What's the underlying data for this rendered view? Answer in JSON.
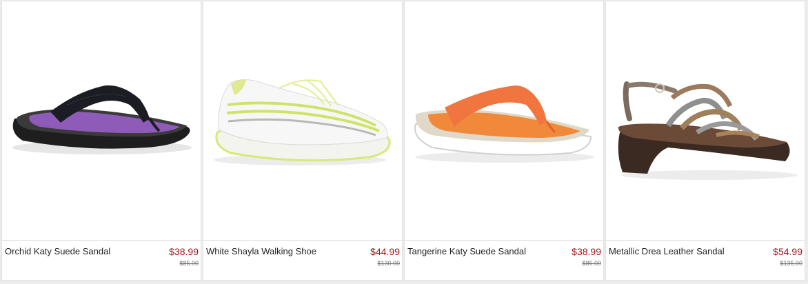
{
  "products": [
    {
      "name": "Orchid Katy Suede Sandal",
      "price": "$38.99",
      "original_price": "$85.00",
      "image_icon": "black-purple-thong-sandal"
    },
    {
      "name": "White Shayla Walking Shoe",
      "price": "$44.99",
      "original_price": "$130.00",
      "image_icon": "white-lime-sneaker"
    },
    {
      "name": "Tangerine Katy Suede Sandal",
      "price": "$38.99",
      "original_price": "$85.00",
      "image_icon": "orange-thong-sandal"
    },
    {
      "name": "Metallic Drea Leather Sandal",
      "price": "$54.99",
      "original_price": "$135.00",
      "image_icon": "metallic-strappy-sandal"
    }
  ],
  "colors": {
    "sale_price": "#a3131a",
    "text": "#222222",
    "original_price": "#777777"
  }
}
